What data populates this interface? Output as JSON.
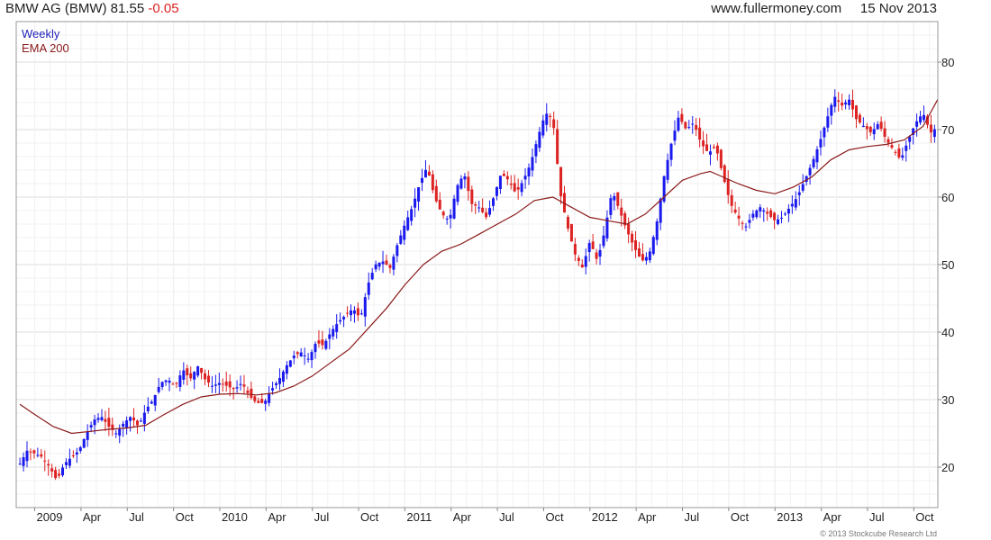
{
  "header": {
    "title": "BMW AG (BMW) 81.55",
    "change": "-0.05",
    "site": "www.fullermoney.com",
    "date": "15 Nov 2013"
  },
  "copyright": "© 2013 Stockcube Research Ltd",
  "colors": {
    "up": "#1a1aee",
    "down": "#dd2222",
    "ema": "#8b1a1a",
    "grid": "#dcdcdc",
    "legend_weekly": "#2222bb",
    "legend_ema": "#8b1a1a"
  },
  "chart_data": {
    "type": "candlestick",
    "legend": [
      "Weekly",
      "EMA 200"
    ],
    "legend_placement": "top-left",
    "grid": true,
    "y_axis_side": "right",
    "ylim": [
      14,
      86
    ],
    "yticks": [
      20,
      30,
      40,
      50,
      60,
      70,
      80
    ],
    "x_ticks": [
      {
        "label": "2009",
        "x": 2009.0
      },
      {
        "label": "Apr",
        "x": 2009.25
      },
      {
        "label": "Jul",
        "x": 2009.5
      },
      {
        "label": "Oct",
        "x": 2009.75
      },
      {
        "label": "2010",
        "x": 2010.0
      },
      {
        "label": "Apr",
        "x": 2010.25
      },
      {
        "label": "Jul",
        "x": 2010.5
      },
      {
        "label": "Oct",
        "x": 2010.75
      },
      {
        "label": "2011",
        "x": 2011.0
      },
      {
        "label": "Apr",
        "x": 2011.25
      },
      {
        "label": "Jul",
        "x": 2011.5
      },
      {
        "label": "Oct",
        "x": 2011.75
      },
      {
        "label": "2012",
        "x": 2012.0
      },
      {
        "label": "Apr",
        "x": 2012.25
      },
      {
        "label": "Jul",
        "x": 2012.5
      },
      {
        "label": "Oct",
        "x": 2012.75
      },
      {
        "label": "2013",
        "x": 2013.0
      },
      {
        "label": "Apr",
        "x": 2013.25
      },
      {
        "label": "Jul",
        "x": 2013.5
      },
      {
        "label": "Oct",
        "x": 2013.75
      }
    ],
    "xlim": [
      2008.9,
      2013.88
    ],
    "close_path": [
      [
        2008.92,
        20.5
      ],
      [
        2008.96,
        22.5
      ],
      [
        2009.0,
        22.0
      ],
      [
        2009.04,
        21.5
      ],
      [
        2009.08,
        20.0
      ],
      [
        2009.12,
        18.0
      ],
      [
        2009.16,
        20.5
      ],
      [
        2009.2,
        21.5
      ],
      [
        2009.24,
        22.5
      ],
      [
        2009.28,
        25.0
      ],
      [
        2009.32,
        27.0
      ],
      [
        2009.36,
        27.5
      ],
      [
        2009.4,
        26.0
      ],
      [
        2009.44,
        25.0
      ],
      [
        2009.48,
        26.5
      ],
      [
        2009.52,
        27.5
      ],
      [
        2009.56,
        26.0
      ],
      [
        2009.6,
        28.5
      ],
      [
        2009.64,
        30.0
      ],
      [
        2009.68,
        32.5
      ],
      [
        2009.72,
        33.0
      ],
      [
        2009.76,
        32.0
      ],
      [
        2009.8,
        34.5
      ],
      [
        2009.84,
        33.0
      ],
      [
        2009.88,
        35.0
      ],
      [
        2009.92,
        33.0
      ],
      [
        2009.96,
        32.0
      ],
      [
        2010.0,
        32.5
      ],
      [
        2010.04,
        32.0
      ],
      [
        2010.08,
        31.5
      ],
      [
        2010.12,
        32.5
      ],
      [
        2010.16,
        30.5
      ],
      [
        2010.2,
        29.5
      ],
      [
        2010.24,
        29.5
      ],
      [
        2010.28,
        31.5
      ],
      [
        2010.32,
        33.0
      ],
      [
        2010.36,
        35.0
      ],
      [
        2010.4,
        36.5
      ],
      [
        2010.44,
        37.0
      ],
      [
        2010.48,
        36.0
      ],
      [
        2010.52,
        38.5
      ],
      [
        2010.56,
        38.0
      ],
      [
        2010.6,
        40.0
      ],
      [
        2010.64,
        41.5
      ],
      [
        2010.68,
        42.5
      ],
      [
        2010.72,
        43.5
      ],
      [
        2010.76,
        42.0
      ],
      [
        2010.8,
        47.0
      ],
      [
        2010.84,
        50.0
      ],
      [
        2010.88,
        50.5
      ],
      [
        2010.92,
        49.5
      ],
      [
        2010.96,
        53.0
      ],
      [
        2011.0,
        56.0
      ],
      [
        2011.04,
        58.5
      ],
      [
        2011.08,
        62.0
      ],
      [
        2011.12,
        64.5
      ],
      [
        2011.16,
        60.0
      ],
      [
        2011.2,
        57.5
      ],
      [
        2011.24,
        56.5
      ],
      [
        2011.28,
        61.5
      ],
      [
        2011.32,
        63.5
      ],
      [
        2011.36,
        59.0
      ],
      [
        2011.4,
        58.5
      ],
      [
        2011.44,
        57.0
      ],
      [
        2011.48,
        60.0
      ],
      [
        2011.52,
        63.5
      ],
      [
        2011.56,
        62.5
      ],
      [
        2011.6,
        60.5
      ],
      [
        2011.64,
        62.5
      ],
      [
        2011.68,
        65.0
      ],
      [
        2011.72,
        69.0
      ],
      [
        2011.76,
        72.5
      ],
      [
        2011.8,
        71.5
      ],
      [
        2011.84,
        60.5
      ],
      [
        2011.88,
        55.5
      ],
      [
        2011.92,
        51.5
      ],
      [
        2011.96,
        49.5
      ],
      [
        2012.0,
        53.5
      ],
      [
        2012.04,
        50.5
      ],
      [
        2012.08,
        55.0
      ],
      [
        2012.12,
        61.0
      ],
      [
        2012.16,
        58.0
      ],
      [
        2012.2,
        55.0
      ],
      [
        2012.24,
        52.5
      ],
      [
        2012.28,
        50.5
      ],
      [
        2012.32,
        51.5
      ],
      [
        2012.36,
        56.0
      ],
      [
        2012.4,
        63.0
      ],
      [
        2012.44,
        68.0
      ],
      [
        2012.48,
        72.0
      ],
      [
        2012.52,
        70.0
      ],
      [
        2012.56,
        71.0
      ],
      [
        2012.6,
        68.0
      ],
      [
        2012.64,
        66.5
      ],
      [
        2012.68,
        67.5
      ],
      [
        2012.72,
        63.0
      ],
      [
        2012.76,
        59.0
      ],
      [
        2012.8,
        57.0
      ],
      [
        2012.84,
        55.5
      ],
      [
        2012.88,
        57.5
      ],
      [
        2012.92,
        58.5
      ],
      [
        2012.96,
        57.5
      ],
      [
        2013.0,
        56.5
      ],
      [
        2013.04,
        57.0
      ],
      [
        2013.08,
        58.5
      ],
      [
        2013.12,
        60.0
      ],
      [
        2013.16,
        62.5
      ],
      [
        2013.2,
        65.0
      ],
      [
        2013.24,
        68.0
      ],
      [
        2013.28,
        71.5
      ],
      [
        2013.32,
        75.0
      ],
      [
        2013.36,
        73.5
      ],
      [
        2013.4,
        74.5
      ],
      [
        2013.44,
        71.5
      ],
      [
        2013.48,
        70.5
      ],
      [
        2013.52,
        69.5
      ],
      [
        2013.56,
        71.0
      ],
      [
        2013.6,
        68.5
      ],
      [
        2013.64,
        67.0
      ],
      [
        2013.68,
        65.5
      ],
      [
        2013.72,
        68.5
      ],
      [
        2013.76,
        71.0
      ],
      [
        2013.8,
        72.5
      ],
      [
        2013.84,
        69.5
      ],
      [
        2013.88,
        70.5
      ]
    ],
    "ema_path": [
      [
        2008.92,
        29.3
      ],
      [
        2009.0,
        27.8
      ],
      [
        2009.1,
        26.0
      ],
      [
        2009.2,
        25.0
      ],
      [
        2009.3,
        25.3
      ],
      [
        2009.4,
        25.6
      ],
      [
        2009.5,
        25.8
      ],
      [
        2009.6,
        26.2
      ],
      [
        2009.7,
        27.8
      ],
      [
        2009.8,
        29.3
      ],
      [
        2009.9,
        30.4
      ],
      [
        2010.0,
        30.8
      ],
      [
        2010.1,
        30.9
      ],
      [
        2010.2,
        30.7
      ],
      [
        2010.3,
        31.0
      ],
      [
        2010.4,
        32.0
      ],
      [
        2010.5,
        33.5
      ],
      [
        2010.6,
        35.5
      ],
      [
        2010.7,
        37.5
      ],
      [
        2010.8,
        40.5
      ],
      [
        2010.9,
        43.5
      ],
      [
        2011.0,
        47.0
      ],
      [
        2011.1,
        50.0
      ],
      [
        2011.2,
        52.0
      ],
      [
        2011.3,
        53.0
      ],
      [
        2011.4,
        54.5
      ],
      [
        2011.5,
        56.0
      ],
      [
        2011.6,
        57.5
      ],
      [
        2011.7,
        59.5
      ],
      [
        2011.8,
        60.0
      ],
      [
        2011.9,
        58.5
      ],
      [
        2012.0,
        57.0
      ],
      [
        2012.1,
        56.5
      ],
      [
        2012.2,
        56.0
      ],
      [
        2012.3,
        57.5
      ],
      [
        2012.4,
        60.0
      ],
      [
        2012.5,
        62.5
      ],
      [
        2012.6,
        63.5
      ],
      [
        2012.65,
        63.8
      ],
      [
        2012.7,
        63.2
      ],
      [
        2012.8,
        62.0
      ],
      [
        2012.9,
        61.0
      ],
      [
        2013.0,
        60.5
      ],
      [
        2013.1,
        61.5
      ],
      [
        2013.2,
        63.0
      ],
      [
        2013.3,
        65.5
      ],
      [
        2013.4,
        67.0
      ],
      [
        2013.5,
        67.5
      ],
      [
        2013.6,
        67.8
      ],
      [
        2013.7,
        68.5
      ],
      [
        2013.8,
        70.5
      ],
      [
        2013.88,
        74.5
      ]
    ]
  }
}
